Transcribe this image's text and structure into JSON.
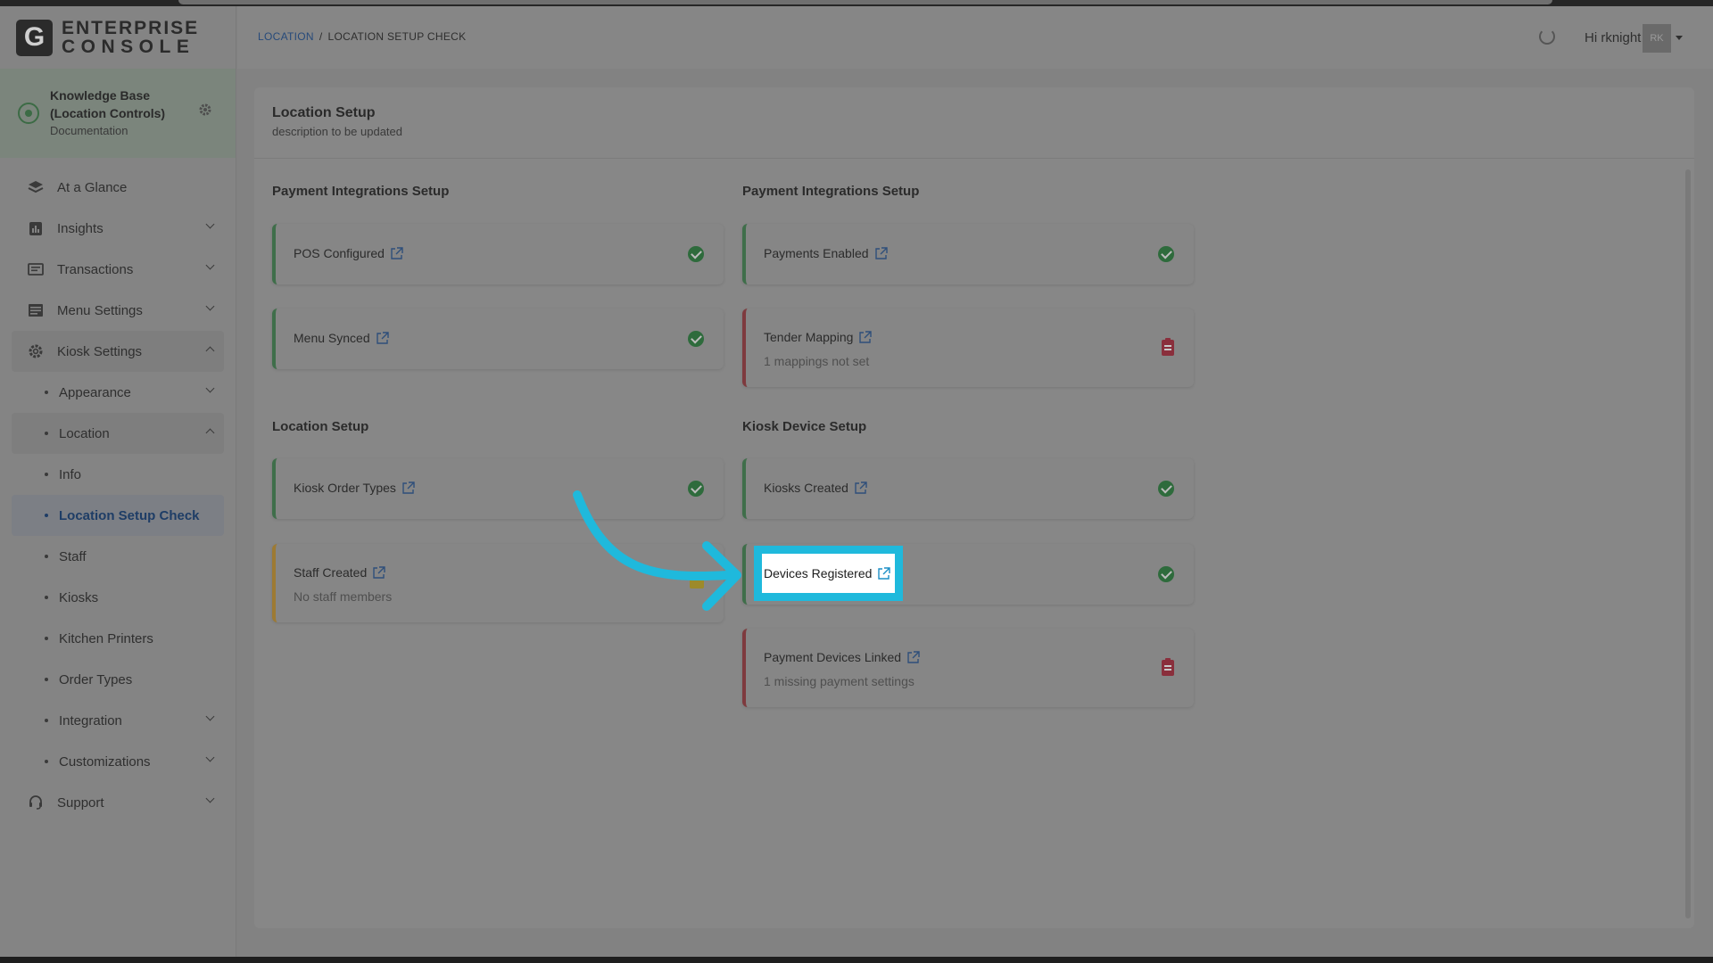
{
  "app": {
    "logo_letter": "G",
    "title_line1": "ENTERPRISE",
    "title_line2": "CONSOLE"
  },
  "org": {
    "title": "Knowledge Base (Location Controls)",
    "subtitle": "Documentation",
    "icon": "location-pin-icon"
  },
  "sidebar": {
    "items": [
      {
        "label": "At a Glance",
        "icon": "layers-icon"
      },
      {
        "label": "Insights",
        "icon": "chart-icon"
      },
      {
        "label": "Transactions",
        "icon": "receipt-icon"
      },
      {
        "label": "Menu Settings",
        "icon": "menu-list-icon"
      },
      {
        "label": "Kiosk Settings",
        "icon": "gear-icon"
      },
      {
        "label": "Support",
        "icon": "headset-icon"
      }
    ],
    "kiosk_sub": [
      {
        "label": "Appearance"
      },
      {
        "label": "Location"
      },
      {
        "label": "Info"
      },
      {
        "label": "Location Setup Check"
      },
      {
        "label": "Staff"
      },
      {
        "label": "Kiosks"
      },
      {
        "label": "Kitchen Printers"
      },
      {
        "label": "Order Types"
      },
      {
        "label": "Integration"
      },
      {
        "label": "Customizations"
      }
    ]
  },
  "header": {
    "breadcrumb_link": "LOCATION",
    "breadcrumb_sep": "/",
    "breadcrumb_current": "LOCATION SETUP CHECK",
    "greeting": "Hi rknight",
    "avatar_initials": "RK"
  },
  "panel": {
    "title": "Location Setup",
    "description": "description to be updated"
  },
  "sections": {
    "left_top": "Payment Integrations Setup",
    "right_top": "Payment Integrations Setup",
    "left_bottom": "Location Setup",
    "right_bottom": "Kiosk Device Setup"
  },
  "cards": {
    "pos": {
      "label": "POS Configured",
      "status": "ok"
    },
    "menu": {
      "label": "Menu Synced",
      "status": "ok"
    },
    "payments": {
      "label": "Payments Enabled",
      "status": "ok"
    },
    "tender": {
      "label": "Tender Mapping",
      "detail": "1 mappings not set",
      "status": "error"
    },
    "order_types": {
      "label": "Kiosk Order Types",
      "status": "ok"
    },
    "staff": {
      "label": "Staff Created",
      "detail": "No staff members",
      "status": "warning"
    },
    "kiosks": {
      "label": "Kiosks Created",
      "status": "ok"
    },
    "devices": {
      "label": "Devices Registered",
      "status": "ok"
    },
    "payment_devices": {
      "label": "Payment Devices Linked",
      "detail": "1 missing payment settings",
      "status": "error"
    }
  },
  "colors": {
    "highlight": "#1fb9dc",
    "ok": "#2e6b3c",
    "error": "#8a2f3c",
    "warning": "#9d7a33",
    "link": "#274a7a"
  }
}
